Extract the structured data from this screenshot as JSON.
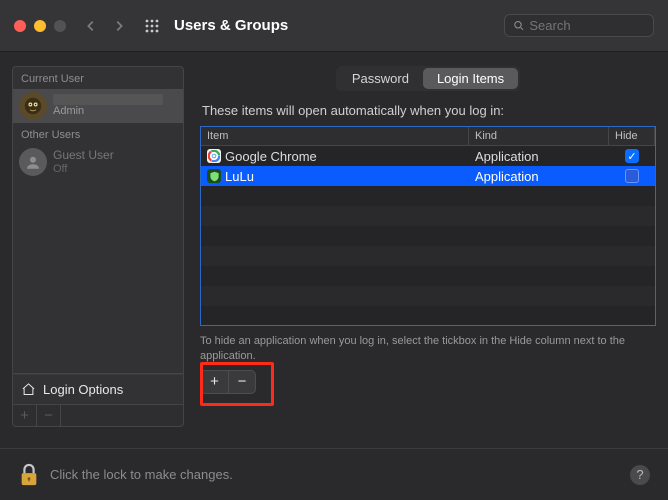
{
  "toolbar": {
    "title": "Users & Groups",
    "search_placeholder": "Search"
  },
  "sidebar": {
    "current_label": "Current User",
    "other_label": "Other Users",
    "current_user": {
      "role": "Admin"
    },
    "guest_user": {
      "name": "Guest User",
      "status": "Off"
    },
    "login_options_label": "Login Options"
  },
  "tabs": [
    {
      "label": "Password",
      "active": false
    },
    {
      "label": "Login Items",
      "active": true
    }
  ],
  "intro": "These items will open automatically when you log in:",
  "columns": {
    "item": "Item",
    "kind": "Kind",
    "hide": "Hide"
  },
  "items": [
    {
      "name": "Google Chrome",
      "kind": "Application",
      "hide": true,
      "selected": false,
      "icon_bg": "#f4f4f4",
      "icon_fg": "#e04f3d"
    },
    {
      "name": "LuLu",
      "kind": "Application",
      "hide": false,
      "selected": true,
      "icon_bg": "#1a4d1a",
      "icon_fg": "#62d957"
    }
  ],
  "hint": "To hide an application when you log in, select the tickbox in the Hide column next to the application.",
  "footer": {
    "lock_text": "Click the lock to make changes."
  }
}
